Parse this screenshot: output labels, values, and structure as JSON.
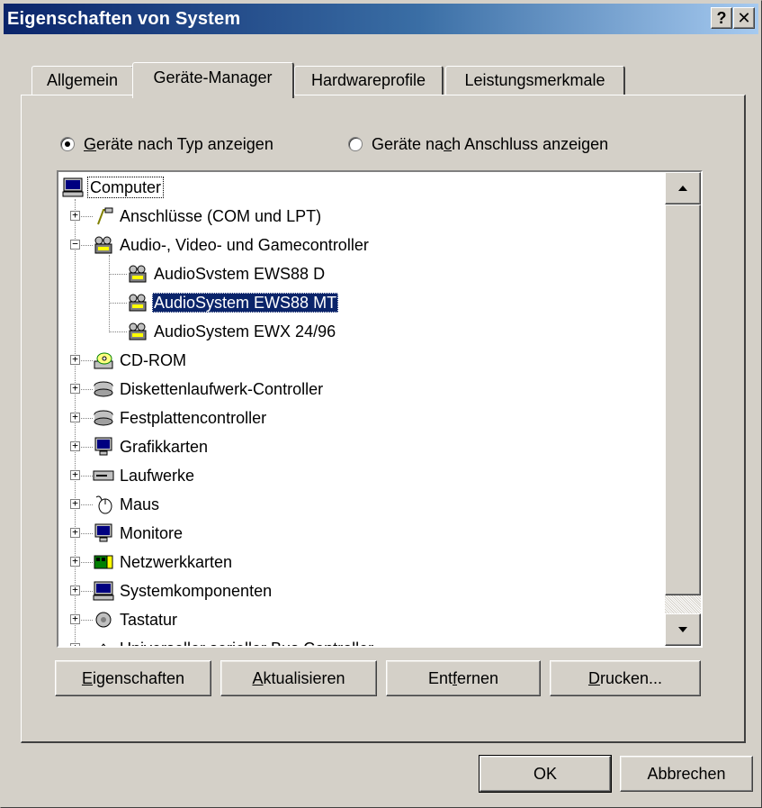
{
  "window": {
    "title": "Eigenschaften von System",
    "help_glyph": "?",
    "close_glyph": "✕"
  },
  "tabs": [
    {
      "label": "Allgemein",
      "active": false
    },
    {
      "label": "Geräte-Manager",
      "active": true
    },
    {
      "label": "Hardwareprofile",
      "active": false
    },
    {
      "label": "Leistungsmerkmale",
      "active": false
    }
  ],
  "view_options": {
    "by_type": {
      "label_mnemonic": "G",
      "label_rest": "eräte nach Typ anzeigen",
      "checked": true
    },
    "by_connection": {
      "label_pre": "Geräte na",
      "label_mnemonic": "c",
      "label_post": "h Anschluss anzeigen",
      "checked": false
    }
  },
  "tree": {
    "root": {
      "label": "Computer",
      "icon": "computer-icon",
      "selected": false
    },
    "items": [
      {
        "label": "Anschlüsse (COM und LPT)",
        "icon": "port-icon",
        "expander": "+"
      },
      {
        "label": "Audio-, Video- und Gamecontroller",
        "icon": "audio-controller-icon",
        "expander": "−"
      },
      {
        "label": "AudioSvstem EWS88 D",
        "icon": "audio-controller-icon",
        "child": true
      },
      {
        "label": "AudioSystem EWS88 MT",
        "icon": "audio-controller-icon",
        "child": true,
        "selected": true
      },
      {
        "label": "AudioSystem EWX 24/96",
        "icon": "audio-controller-icon",
        "child": true
      },
      {
        "label": "CD-ROM",
        "icon": "cdrom-icon",
        "expander": "+"
      },
      {
        "label": "Diskettenlaufwerk-Controller",
        "icon": "disk-controller-icon",
        "expander": "+"
      },
      {
        "label": "Festplattencontroller",
        "icon": "disk-controller-icon",
        "expander": "+"
      },
      {
        "label": "Grafikkarten",
        "icon": "monitor-icon",
        "expander": "+"
      },
      {
        "label": "Laufwerke",
        "icon": "drive-icon",
        "expander": "+"
      },
      {
        "label": "Maus",
        "icon": "mouse-icon",
        "expander": "+"
      },
      {
        "label": "Monitore",
        "icon": "monitor-icon",
        "expander": "+"
      },
      {
        "label": "Netzwerkkarten",
        "icon": "network-card-icon",
        "expander": "+"
      },
      {
        "label": "Systemkomponenten",
        "icon": "computer-icon",
        "expander": "+"
      },
      {
        "label": "Tastatur",
        "icon": "keyboard-icon",
        "expander": "+"
      },
      {
        "label": "Universeller serieller Bus Controller",
        "icon": "usb-icon",
        "expander": "+"
      }
    ]
  },
  "action_buttons": {
    "properties": {
      "mnemonic": "E",
      "rest": "igenschaften"
    },
    "refresh": {
      "mnemonic": "A",
      "rest": "ktualisieren"
    },
    "remove": {
      "pre": "Ent",
      "mnemonic": "f",
      "post": "ernen"
    },
    "print": {
      "mnemonic": "D",
      "rest": "rucken..."
    }
  },
  "dialog_buttons": {
    "ok": "OK",
    "cancel": "Abbrechen"
  },
  "colors": {
    "title_start": "#0a246a",
    "title_end": "#a6caf0",
    "face": "#d4d0c8",
    "selection": "#0a246a"
  }
}
